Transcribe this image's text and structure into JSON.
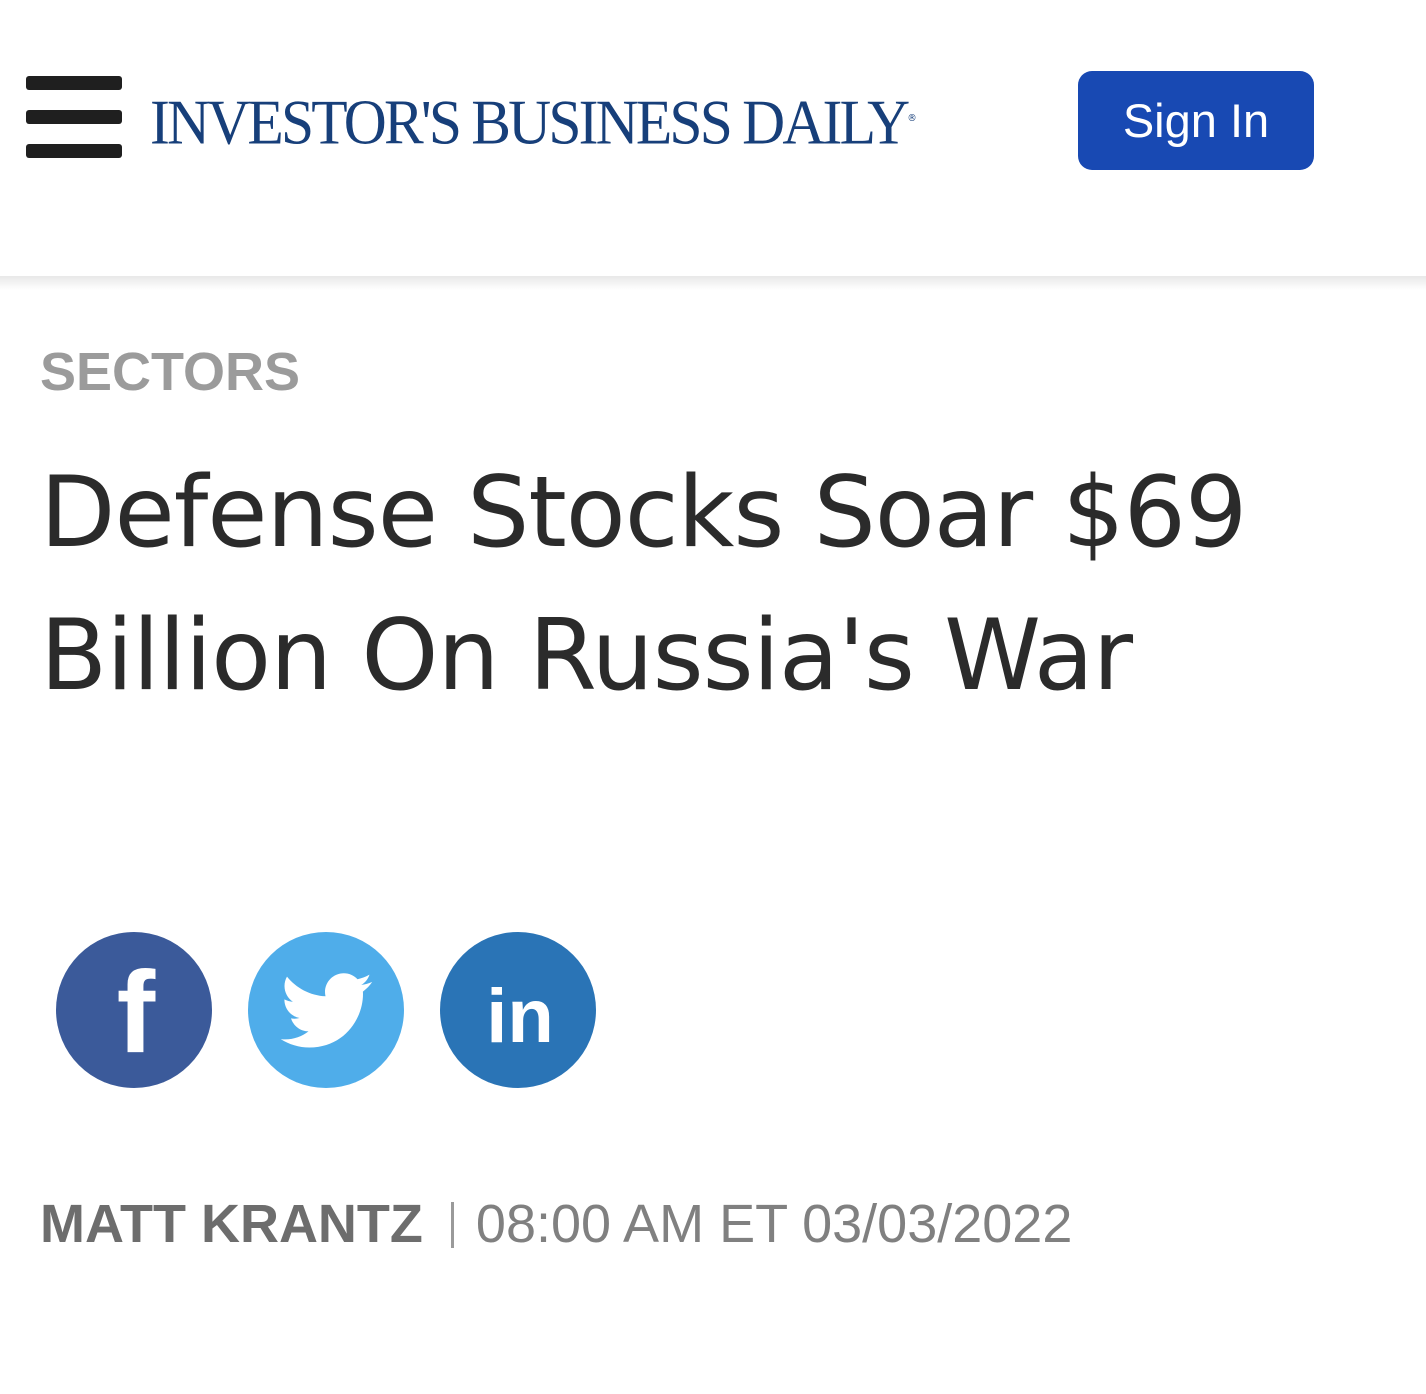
{
  "header": {
    "logo_text": "INVESTOR'S BUSINESS DAILY",
    "logo_mark": "®",
    "signin_label": "Sign In",
    "brand_color": "#173f7a",
    "signin_color": "#1849b3"
  },
  "article": {
    "section": "SECTORS",
    "headline": "Defense Stocks Soar $69 Billion On Russia's War",
    "author": "MATT KRANTZ",
    "timestamp": "08:00 AM ET 03/03/2022"
  },
  "share": [
    {
      "network": "facebook",
      "icon": "facebook-icon",
      "glyph": "f",
      "color": "#3b5a9a"
    },
    {
      "network": "twitter",
      "icon": "twitter-bird-icon",
      "color": "#4fadea"
    },
    {
      "network": "linkedin",
      "icon": "linkedin-icon",
      "glyph": "in",
      "color": "#2a74b6"
    }
  ]
}
